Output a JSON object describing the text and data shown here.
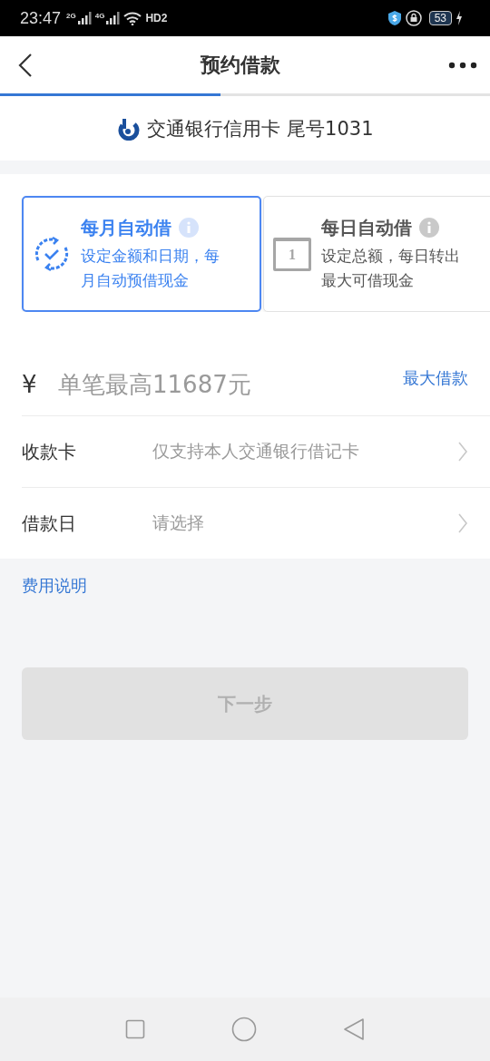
{
  "status_bar": {
    "time": "23:47",
    "signals": [
      {
        "label": "2G"
      },
      {
        "label": "4G"
      }
    ],
    "hd": "HD2",
    "battery": "53"
  },
  "header": {
    "title": "预约借款"
  },
  "progress": {
    "level": 0.45
  },
  "card": {
    "name": "交通银行信用卡 尾号1031"
  },
  "options": [
    {
      "kind": "monthly",
      "title": "每月自动借",
      "desc": "设定金额和日期，每月自动预借现金",
      "selected": true
    },
    {
      "kind": "daily",
      "title": "每日自动借",
      "desc": "设定总额，每日转出最大可借现金",
      "selected": false,
      "calendar_day": "1"
    }
  ],
  "amount": {
    "currency": "¥",
    "placeholder": "单笔最高11687元",
    "link": "最大借款"
  },
  "rows": [
    {
      "label": "收款卡",
      "placeholder": "仅支持本人交通银行借记卡"
    },
    {
      "label": "借款日",
      "placeholder": "请选择"
    }
  ],
  "fee_link": "费用说明",
  "next_button": {
    "label": "下一步",
    "disabled": true
  }
}
